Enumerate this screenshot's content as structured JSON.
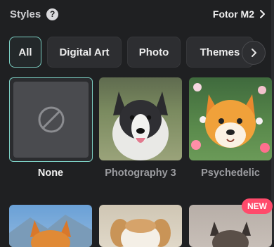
{
  "header": {
    "title": "Styles",
    "model_label": "Fotor M2"
  },
  "tabs": [
    {
      "label": "All",
      "active": true
    },
    {
      "label": "Digital Art"
    },
    {
      "label": "Photo"
    },
    {
      "label": "Themes"
    }
  ],
  "styles": [
    {
      "label": "None",
      "selected": true,
      "icon": "none-icon"
    },
    {
      "label": "Photography 3"
    },
    {
      "label": "Psychedelic"
    },
    {
      "label": ""
    },
    {
      "label": ""
    },
    {
      "label": "",
      "badge": "NEW"
    }
  ],
  "colors": {
    "accent": "#7ccfc3",
    "background": "#1f2022",
    "badge": "#ff4a6b"
  }
}
